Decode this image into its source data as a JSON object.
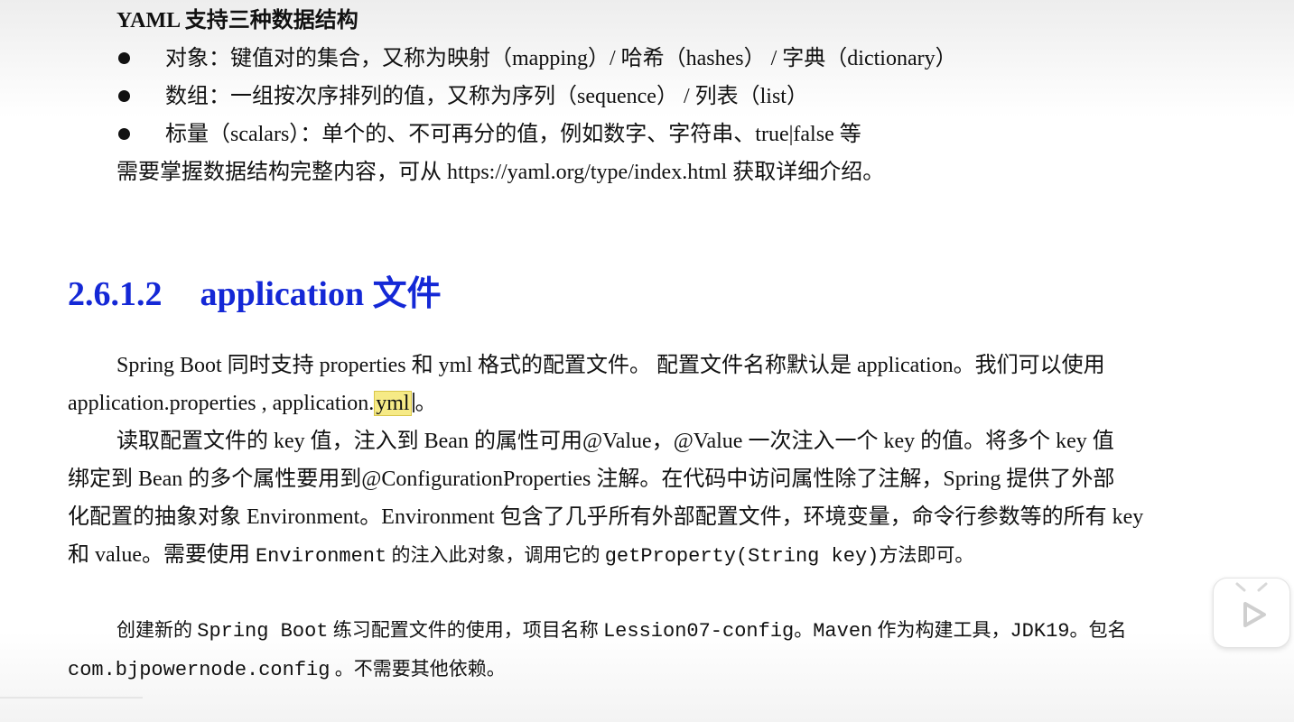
{
  "yaml_section": {
    "title": "YAML 支持三种数据结构",
    "bullets": [
      "对象：键值对的集合，又称为映射（mapping）/  哈希（hashes）  /  字典（dictionary）",
      "数组：一组按次序排列的值，又称为序列（sequence）  /  列表（list）",
      "标量（scalars）：单个的、不可再分的值，例如数字、字符串、true|false 等"
    ],
    "note": "需要掌握数据结构完整内容，可从 https://yaml.org/type/index.html 获取详细介绍。"
  },
  "heading": {
    "number": "2.6.1.2",
    "title": "application 文件"
  },
  "para1": {
    "line1": "Spring Boot 同时支持 properties 和 yml 格式的配置文件。  配置文件名称默认是 application。我们可以使用",
    "line2_prefix": "application.properties , application.",
    "line2_highlight": "yml",
    "line2_suffix": "。"
  },
  "para2": {
    "line1": "读取配置文件的 key 值，注入到 Bean 的属性可用@Value，@Value 一次注入一个 key 的值。将多个 key 值",
    "line2": "绑定到 Bean 的多个属性要用到@ConfigurationProperties 注解。在代码中访问属性除了注解，Spring 提供了外部",
    "line3": "化配置的抽象对象 Environment。Environment 包含了几乎所有外部配置文件，环境变量，命令行参数等的所有 key",
    "line4_a": "和 value。需要使用 ",
    "line4_code1": "Environment",
    "line4_b": " 的注入此对象，调用它的 ",
    "line4_code2": "getProperty(String key)",
    "line4_c": "方法即可。"
  },
  "para3": {
    "l1_a": "创建新的 ",
    "l1_code1": "Spring Boot",
    "l1_b": " 练习配置文件的使用，项目名称 ",
    "l1_code2": "Lession07-config",
    "l1_c": "。",
    "l1_code3": "Maven",
    "l1_d": " 作为构建工具，",
    "l1_code4": "JDK19",
    "l1_e": "。包名",
    "l2_code": "com.bjpowernode.config",
    "l2_tail": " 。不需要其他依赖。"
  },
  "player": {
    "icon": "play-icon"
  }
}
